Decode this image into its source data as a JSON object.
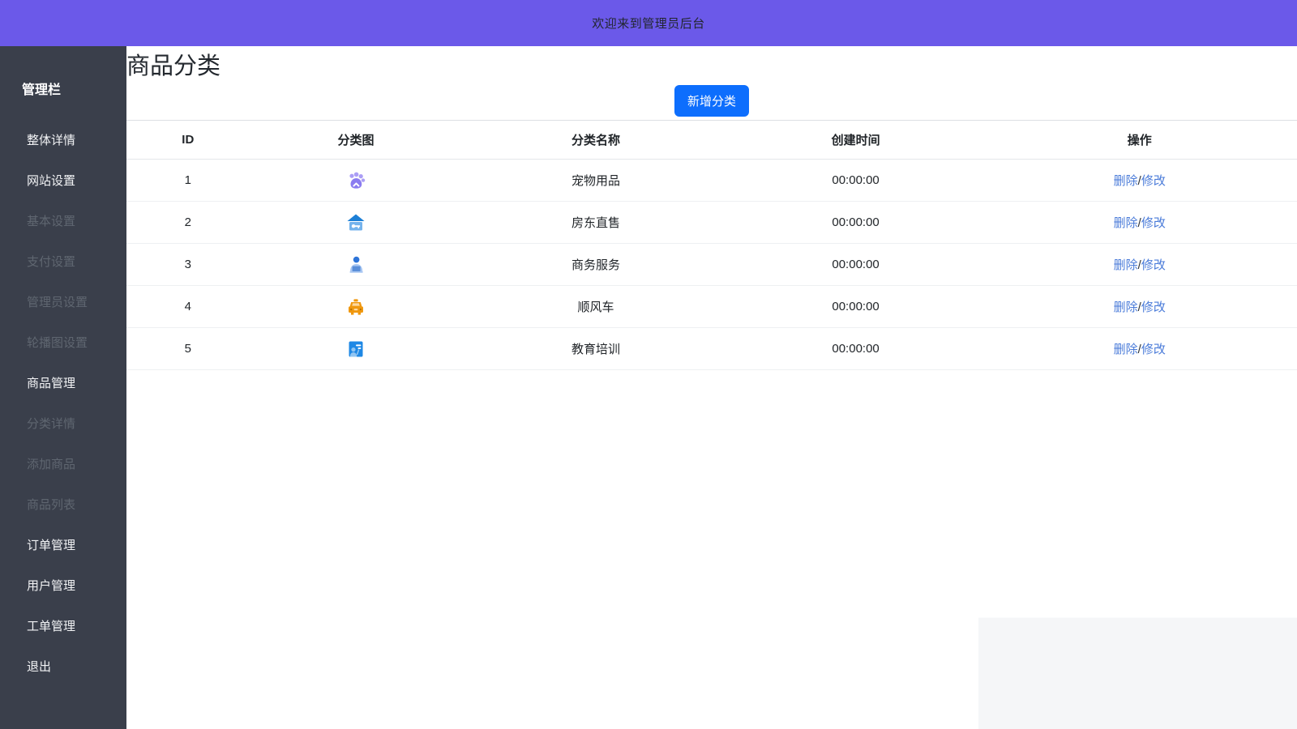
{
  "topbar": {
    "welcome_text": "欢迎来到管理员后台",
    "background_color": "#6b59e9"
  },
  "sidebar": {
    "title": "管理栏",
    "background_color": "#3a3f4b",
    "items": [
      {
        "key": "overview",
        "label": "整体详情",
        "muted": false
      },
      {
        "key": "site-settings",
        "label": "网站设置",
        "muted": false
      },
      {
        "key": "basic-settings",
        "label": "基本设置",
        "muted": true
      },
      {
        "key": "payment-settings",
        "label": "支付设置",
        "muted": true
      },
      {
        "key": "admin-settings",
        "label": "管理员设置",
        "muted": true
      },
      {
        "key": "carousel-settings",
        "label": "轮播图设置",
        "muted": true
      },
      {
        "key": "product-mgmt",
        "label": "商品管理",
        "muted": false
      },
      {
        "key": "category-detail",
        "label": "分类详情",
        "muted": true
      },
      {
        "key": "add-product",
        "label": "添加商品",
        "muted": true
      },
      {
        "key": "product-list",
        "label": "商品列表",
        "muted": true
      },
      {
        "key": "order-mgmt",
        "label": "订单管理",
        "muted": false
      },
      {
        "key": "user-mgmt",
        "label": "用户管理",
        "muted": false
      },
      {
        "key": "ticket-mgmt",
        "label": "工单管理",
        "muted": false
      },
      {
        "key": "logout",
        "label": "退出",
        "muted": false
      }
    ]
  },
  "page": {
    "title": "商品分类",
    "add_button_label": "新增分类",
    "add_button_color": "#0d6efd"
  },
  "table": {
    "columns": [
      "ID",
      "分类图",
      "分类名称",
      "创建时间",
      "操作"
    ],
    "rows": [
      {
        "id": "1",
        "icon": "paw-icon",
        "icon_color": "#8b7cf0",
        "name": "宠物用品",
        "created": "00:00:00"
      },
      {
        "id": "2",
        "icon": "house-key-icon",
        "icon_color": "#2a8ae0",
        "name": "房东直售",
        "created": "00:00:00"
      },
      {
        "id": "3",
        "icon": "person-laptop-icon",
        "icon_color": "#3c7fd9",
        "name": "商务服务",
        "created": "00:00:00"
      },
      {
        "id": "4",
        "icon": "taxi-icon",
        "icon_color": "#f0980f",
        "name": "顺风车",
        "created": "00:00:00"
      },
      {
        "id": "5",
        "icon": "education-icon",
        "icon_color": "#1e88e5",
        "name": "教育培训",
        "created": "00:00:00"
      }
    ],
    "actions": {
      "delete_label": "删除",
      "separator": "/",
      "modify_label": "修改",
      "link_color": "#4a7bd9"
    }
  }
}
